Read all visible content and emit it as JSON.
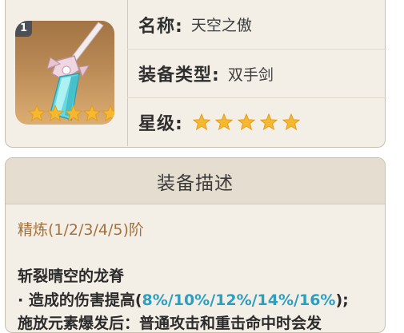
{
  "weapon": {
    "refine_badge": "1",
    "name_label": "名称:",
    "name_value": "天空之傲",
    "type_label": "装备类型:",
    "type_value": "双手剑",
    "rarity_label": "星级:",
    "rarity_stars": 5,
    "star_color": "#f5b82e"
  },
  "description": {
    "header": "装备描述",
    "refinement": "精炼(1/2/3/4/5)阶",
    "passive_name": "斩裂晴空的龙脊",
    "effect_prefix": "· 造成的伤害提高(",
    "effect_values": "8%/10%/12%/14%/16%",
    "effect_suffix": ");",
    "effect_line2": "施放元素爆发后：普通攻击和重击命中时会发"
  },
  "colors": {
    "card_bg": "#f4efe6",
    "header_bg": "#e5ddd0",
    "highlight": "#2a9fc0",
    "refine_text": "#a4713c"
  }
}
